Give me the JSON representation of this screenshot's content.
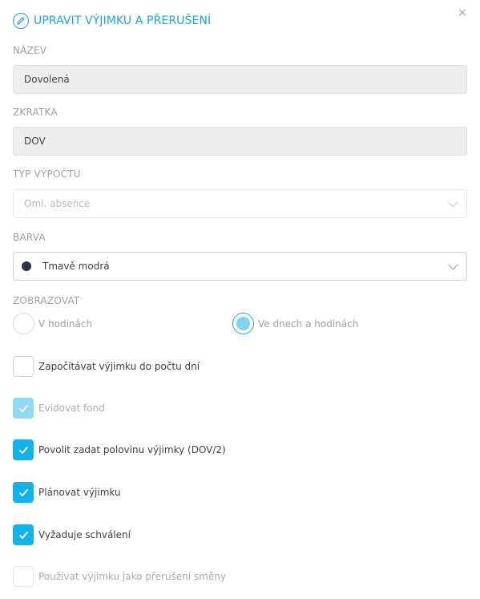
{
  "dialog": {
    "title": "UPRAVIT VÝJIMKU A PŘERUŠENÍ",
    "title_icon": "pencil-icon",
    "close_label": "×",
    "accent_color": "#1fa4d6"
  },
  "fields": {
    "name": {
      "label": "NÁZEV",
      "value": "Dovolená"
    },
    "abbreviation": {
      "label": "ZKRATKA",
      "value": "DOV"
    },
    "calc_type": {
      "label": "TYP VÝPOČTU",
      "value": "Oml. absence"
    },
    "color": {
      "label": "BARVA",
      "value": "Tmavě modrá",
      "swatch": "#2b3349"
    }
  },
  "display": {
    "label": "ZOBRAZOVAT",
    "options": [
      {
        "label": "V hodinách",
        "selected": false
      },
      {
        "label": "Ve dnech a hodinách",
        "selected": true
      }
    ]
  },
  "checkboxes": [
    {
      "label": "Započítávat výjimku do počtu dní",
      "checked": false,
      "disabled": false
    },
    {
      "label": "Evidovat fond",
      "checked": true,
      "disabled": true
    },
    {
      "label": "Povolit zadat polovinu výjimky (DOV/2)",
      "checked": true,
      "disabled": false
    },
    {
      "label": "Plánovat výjimku",
      "checked": true,
      "disabled": false
    },
    {
      "label": "Vyžaduje schválení",
      "checked": true,
      "disabled": false
    },
    {
      "label": "Používat výjimku jako přerušení směny",
      "checked": false,
      "disabled": true
    }
  ]
}
